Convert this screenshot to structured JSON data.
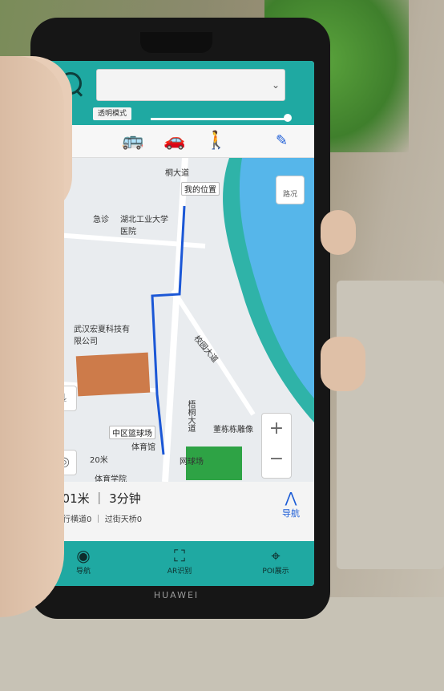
{
  "brand": "HUAWEI",
  "top": {
    "mode_chip": "透明模式",
    "search_placeholder": ""
  },
  "modes": {
    "back": "‹",
    "bus": "🚌",
    "car": "🚗",
    "walk": "🚶",
    "edit": "✎"
  },
  "map": {
    "my_location": "我的位置",
    "road_label_1": "桐大道",
    "hospital": "湖北工业大学医院",
    "emergency": "急诊",
    "company": "武汉宏夏科技有限公司",
    "basketball": "中区篮球场",
    "gym": "体育馆",
    "ball_field": "网球场",
    "statue": "董栋栋雕像",
    "school": "体育学院",
    "road_label_2": "梧桐大道",
    "road_label_3": "校园大道",
    "scale": "20米",
    "road_icon_label": "路况"
  },
  "route": {
    "distance_time": "201米 ｜ 3分钟",
    "details": "人行横道0 ｜ 过街天桥0",
    "nav_label": "导航"
  },
  "bottom_tabs": [
    {
      "label": "导航",
      "icon": "compass-icon"
    },
    {
      "label": "AR识别",
      "icon": "scan-icon"
    },
    {
      "label": "POI展示",
      "icon": "pin-icon"
    }
  ]
}
